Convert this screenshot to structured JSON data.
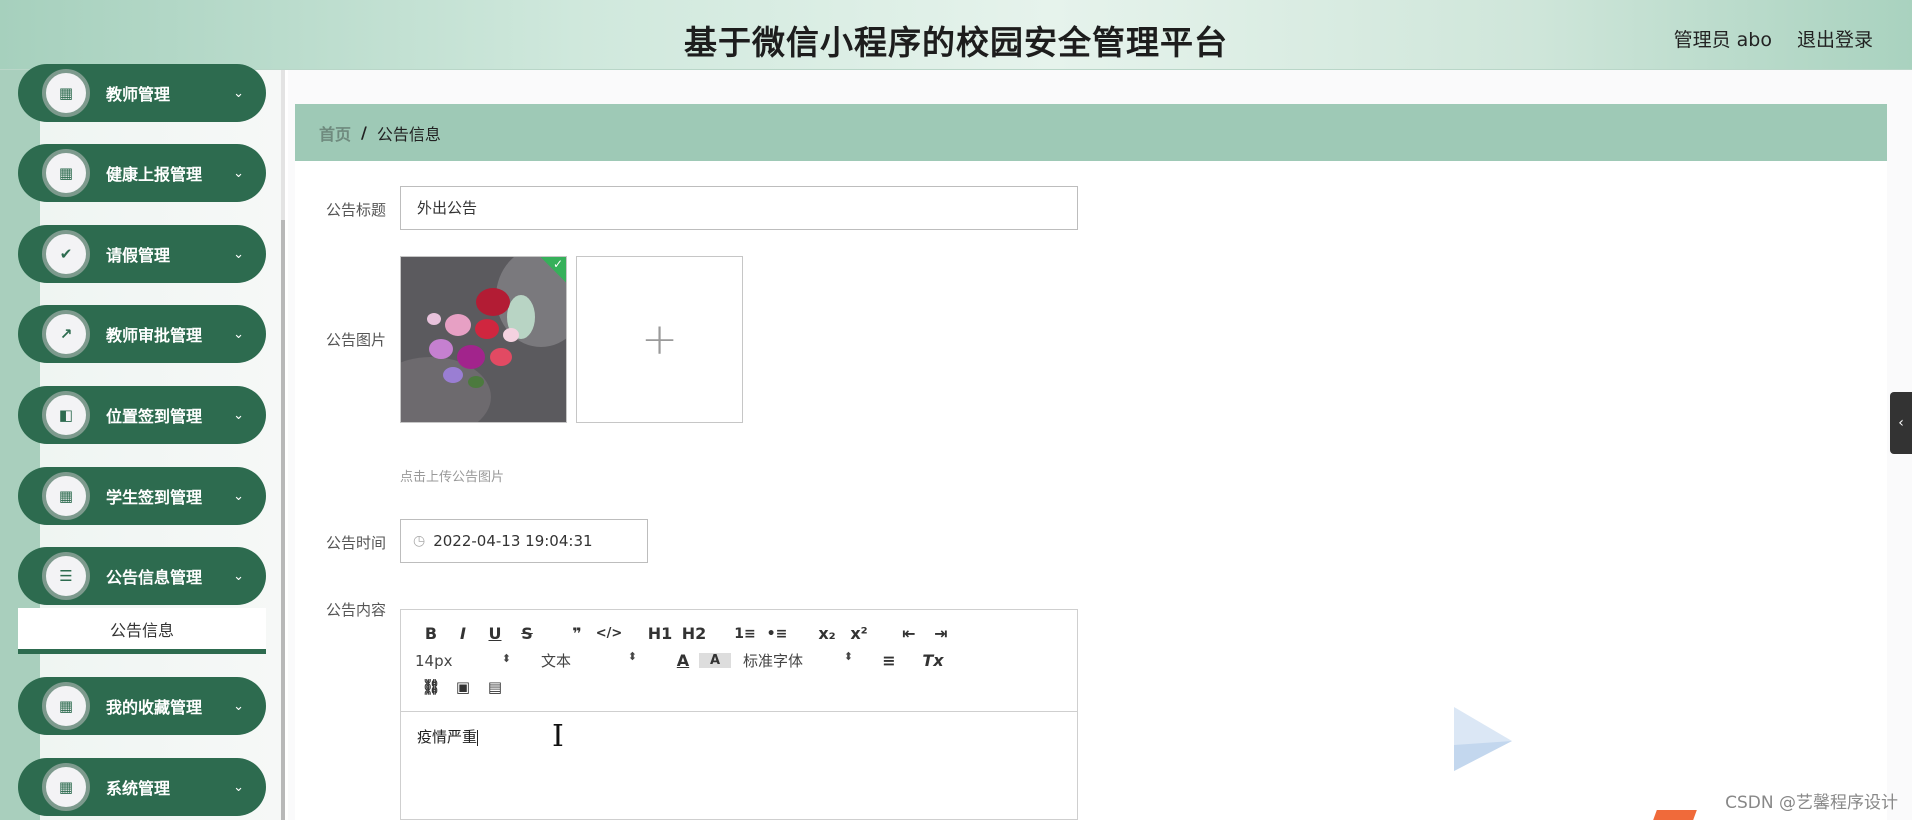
{
  "header": {
    "title": "基于微信小程序的校园安全管理平台",
    "user": "管理员 abo",
    "logout": "退出登录"
  },
  "sidebar": {
    "items": [
      {
        "label": "教师管理",
        "icon": "grid-icon",
        "glyph": "▦"
      },
      {
        "label": "健康上报管理",
        "icon": "apps-icon",
        "glyph": "▦"
      },
      {
        "label": "请假管理",
        "icon": "clipboard-check-icon",
        "glyph": "✔"
      },
      {
        "label": "教师审批管理",
        "icon": "chart-icon",
        "glyph": "↗"
      },
      {
        "label": "位置签到管理",
        "icon": "wallet-icon",
        "glyph": "◧"
      },
      {
        "label": "学生签到管理",
        "icon": "grid-icon",
        "glyph": "▦"
      },
      {
        "label": "公告信息管理",
        "icon": "list-icon",
        "glyph": "☰"
      },
      {
        "label": "我的收藏管理",
        "icon": "grid-icon",
        "glyph": "▦"
      },
      {
        "label": "系统管理",
        "icon": "grid-icon",
        "glyph": "▦"
      }
    ],
    "active_sub": "公告信息",
    "chevron": "⌄"
  },
  "breadcrumb": {
    "home": "首页",
    "separator": "/",
    "current": "公告信息"
  },
  "form": {
    "title_label": "公告标题",
    "title_value": "外出公告",
    "image_label": "公告图片",
    "upload_hint": "点击上传公告图片",
    "time_label": "公告时间",
    "time_value": "2022-04-13 19:04:31",
    "content_label": "公告内容",
    "content_value": "疫情严重"
  },
  "editor": {
    "row1": [
      "B",
      "I",
      "U",
      "S",
      "❞",
      "</>",
      "H1",
      "H2",
      "1≡",
      "•≡",
      "x₂",
      "x²",
      "⇤",
      "⇥"
    ],
    "font_size": "14px",
    "block_type": "文本",
    "font_family": "标准字体",
    "clear_format": "Tx"
  },
  "watermark": "CSDN @艺馨程序设计",
  "colors": {
    "sidebar_pill": "#2d6b4f",
    "breadcrumb_bg": "#9ec9b6",
    "header_gradient": "#cfe8dc"
  }
}
